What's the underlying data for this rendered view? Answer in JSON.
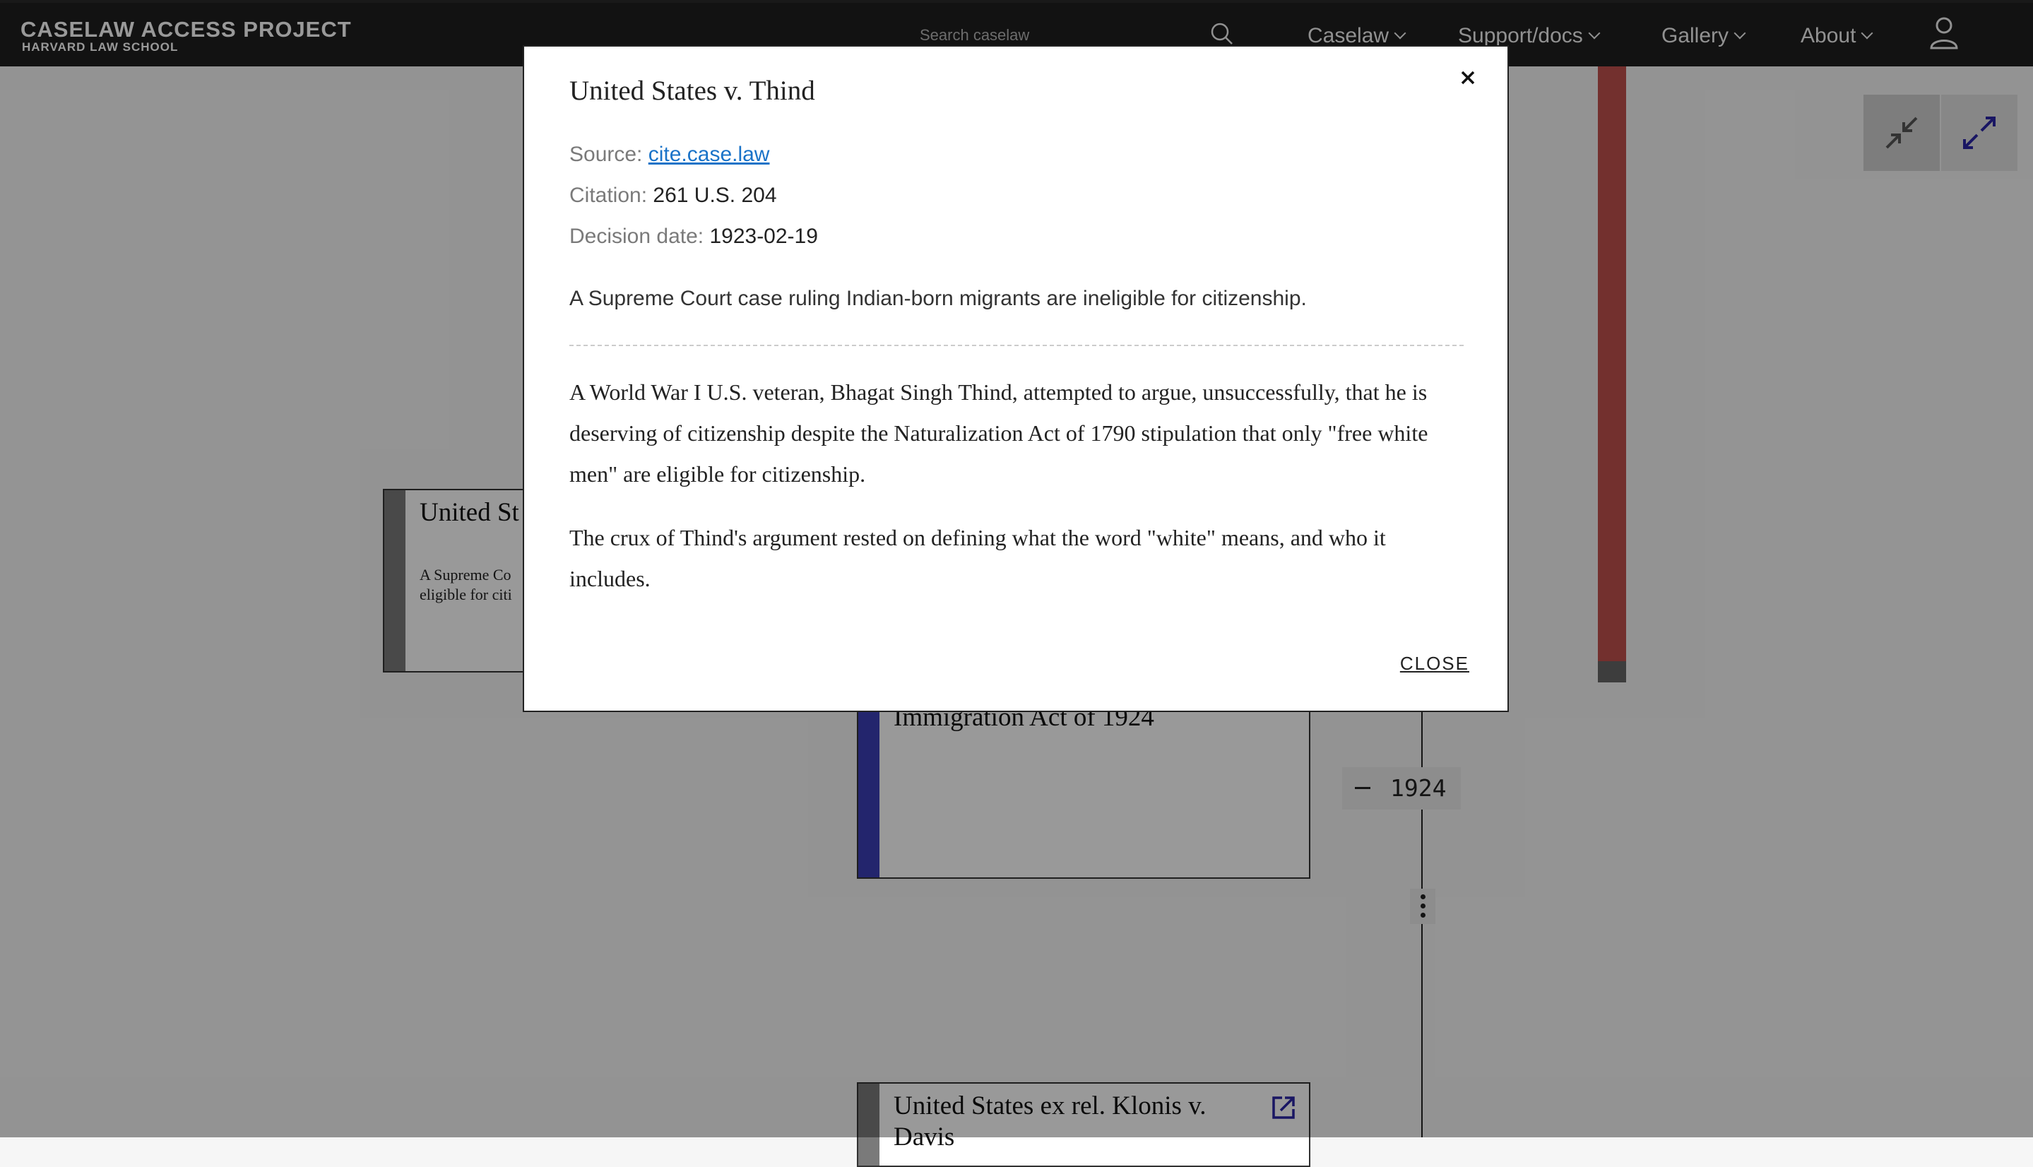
{
  "header": {
    "brand_name": "CASELAW ACCESS PROJECT",
    "brand_sub": "HARVARD LAW SCHOOL",
    "search_placeholder": "Search caselaw",
    "nav": [
      "Caselaw",
      "Support/docs",
      "Gallery",
      "About"
    ]
  },
  "timeline": {
    "year": "1924",
    "cards": [
      {
        "title": "United St",
        "summary": "A Supreme Co",
        "summary2": "eligible for citi"
      },
      {
        "title": "Immigration Act of 1924"
      },
      {
        "title": "United States ex rel. Klonis v.",
        "title2": "Davis"
      }
    ],
    "colors": {
      "red_bar": "#c0504d",
      "stripe_blue": "#3b3fb6",
      "stripe_gray": "#7a7a7a"
    }
  },
  "modal": {
    "title": "United States v. Thind",
    "source_label": "Source:",
    "source_link": "cite.case.law",
    "citation_label": "Citation:",
    "citation_value": "261 U.S. 204",
    "decision_label": "Decision date:",
    "decision_value": "1923-02-19",
    "summary": "A Supreme Court case ruling Indian-born migrants are ineligible for citizenship.",
    "paragraphs": [
      "A World War I U.S. veteran, Bhagat Singh Thind, attempted to argue, unsuccessfully, that he is deserving of citizenship despite the Naturalization Act of 1790 stipulation that only \"free white men\" are eligible for citizenship.",
      "The crux of Thind's argument rested on defining what the word \"white\" means, and who it includes."
    ],
    "close_label": "CLOSE"
  }
}
